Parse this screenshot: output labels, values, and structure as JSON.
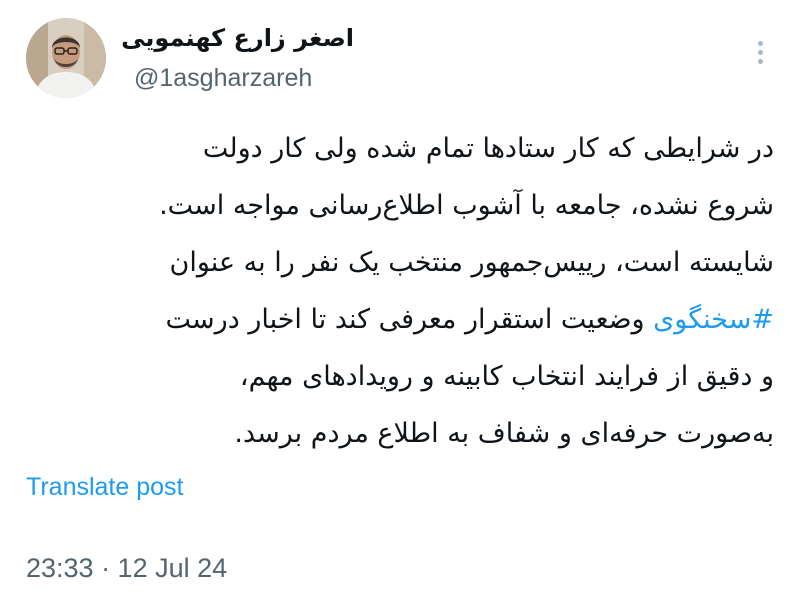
{
  "tweet": {
    "author_name": "اصغر زارع کهنمویی",
    "handle": "@1asgharzareh",
    "lines": [
      "در شرایطی که کار ستادها تمام شده ولی کار دولت",
      "شروع نشده، جامعه با آشوب اطلاع‌رسانی مواجه است.",
      "شایسته است، رییس‌جمهور منتخب یک نفر را به عنوان",
      "وضعیت استقرار معرفی کند تا اخبار درست",
      "و دقیق از فرایند انتخاب کابینه و رویدادهای مهم،",
      "به‌صورت حرفه‌ای و شفاف به اطلاع مردم برسد."
    ],
    "hashtag": "#سخنگوی",
    "translate_label": "Translate post",
    "timestamp": "23:33 · 12 Jul 24"
  },
  "icons": {
    "more": "more-options-icon",
    "avatar": "profile-photo"
  },
  "colors": {
    "link": "#1d9bf0",
    "secondary": "#536471",
    "text": "#0f1419"
  }
}
